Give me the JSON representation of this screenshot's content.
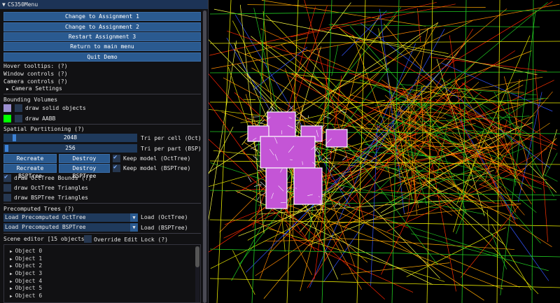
{
  "window": {
    "title": "CS350Menu"
  },
  "buttons": {
    "assignment1": "Change to Assignment 1",
    "assignment2": "Change to Assignment 2",
    "restart3": "Restart Assignment 3",
    "main_menu": "Return to main menu",
    "quit": "Quit Demo"
  },
  "help": {
    "hover_tooltips": "Hover tooltips: (?)",
    "window_controls": "Window controls (?)",
    "camera_controls": "Camera controls (?)",
    "camera_settings": "Camera Settings"
  },
  "bounding_volumes": {
    "heading": "Bounding Volumes",
    "solid_label": "draw solid objects",
    "aabb_label": "draw AABB",
    "solid_color": "#9b8fd0",
    "aabb_color": "#00ff00"
  },
  "spatial": {
    "heading": "Spatial Partitioning (?)",
    "tri_per_cell_value": "2048",
    "tri_per_cell_label": "Tri per cell (Oct)",
    "tri_per_part_value": "256",
    "tri_per_part_label": "Tri per part (BSP)",
    "recreate_oct": "Recreate OctTree",
    "destroy_oct": "Destroy OctTree",
    "keep_oct": "Keep model (OctTree)",
    "recreate_bsp": "Recreate BSPTree",
    "destroy_bsp": "Destroy BSPTree",
    "keep_bsp": "Keep model (BSPTree)",
    "draw_oct_bounds": "draw OctTree Bounds (?)",
    "draw_oct_tris": "draw OctTree Triangles",
    "draw_bsp_tris": "draw BSPTree Triangles"
  },
  "precomputed": {
    "heading": "Precomputed Trees (?)",
    "oct_combo": "Load Precomputed OctTree",
    "oct_label": "Load (OctTree)",
    "bsp_combo": "Load Precomputed BSPTree",
    "bsp_label": "Load (BSPTree)"
  },
  "scene_editor": {
    "heading": "Scene editor [15 objects]",
    "override_label": "Override Edit Lock (?)",
    "objects": [
      "Object 0",
      "Object 1",
      "Object 2",
      "Object 3",
      "Object 4",
      "Object 5",
      "Object 6"
    ]
  }
}
